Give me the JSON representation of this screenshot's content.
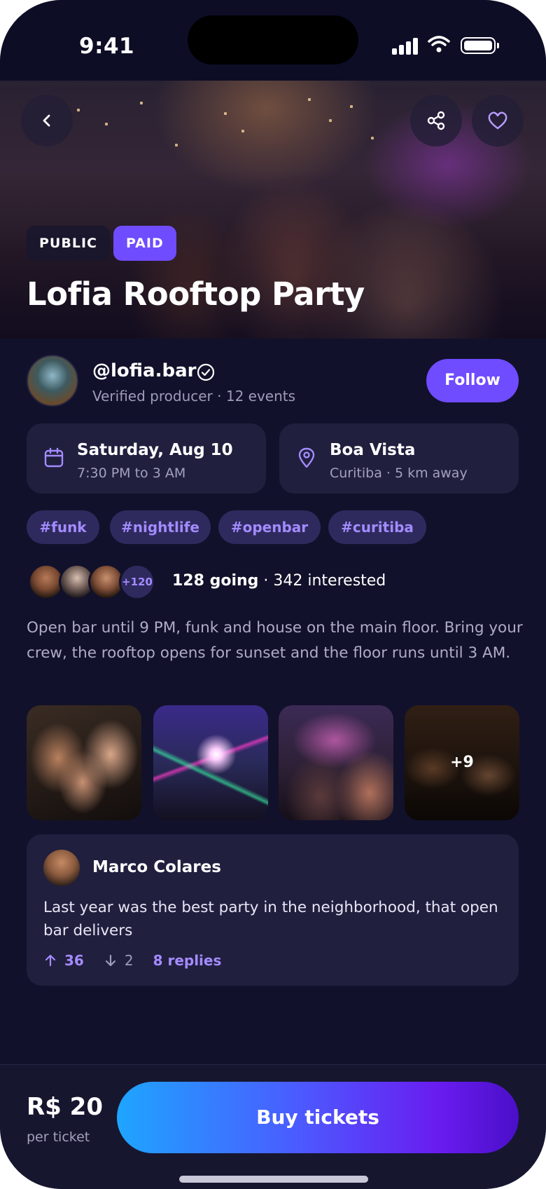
{
  "status_bar": {
    "time": "9:41"
  },
  "event": {
    "title": "Lofia Rooftop Party",
    "badges": [
      "PUBLIC",
      "PAID"
    ]
  },
  "producer": {
    "handle": "@lofia.bar",
    "subtitle": "Verified producer · 12 events",
    "follow_label": "Follow"
  },
  "date_card": {
    "title": "Saturday, Aug 10",
    "subtitle": "7:30 PM to 3 AM"
  },
  "location_card": {
    "title": "Boa Vista",
    "subtitle": "Curitiba · 5 km away"
  },
  "tags": [
    "#funk",
    "#nightlife",
    "#openbar",
    "#curitiba"
  ],
  "attendance": {
    "extra_count": "+120",
    "going": "128 going",
    "separator": " · ",
    "interested": "342 interested"
  },
  "description": "Open bar until 9 PM, funk and house on the main floor. Bring your crew, the rooftop opens for sunset and the floor runs until 3 AM.",
  "gallery": {
    "more_label": "+9"
  },
  "comment": {
    "author": "Marco Colares",
    "text": "Last year was the best party in the neighborhood, that open bar delivers",
    "upvotes": "36",
    "downvotes": "2",
    "replies": "8 replies"
  },
  "footer": {
    "price": "R$ 20",
    "price_sub": "per ticket",
    "buy_label": "Buy tickets"
  },
  "colors": {
    "background": "#12112b",
    "card": "#201f3e",
    "accent": "#6f4cff",
    "tag_text": "#a48bff"
  },
  "icons": [
    "back-chevron-icon",
    "share-icon",
    "heart-icon",
    "verified-icon",
    "calendar-icon",
    "location-pin-icon",
    "arrow-up-icon",
    "arrow-down-icon"
  ]
}
